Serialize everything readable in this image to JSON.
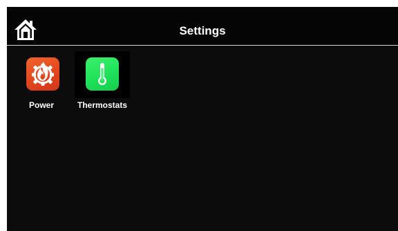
{
  "header": {
    "title": "Settings",
    "home_icon": "home-icon"
  },
  "tiles": [
    {
      "label": "Power",
      "icon": "power-flame-gear-icon",
      "color": "#e8501f",
      "selected": false
    },
    {
      "label": "Thermostats",
      "icon": "thermometer-icon",
      "color": "#22e05a",
      "selected": true
    }
  ],
  "colors": {
    "background": "#0c0c0c",
    "header_divider": "#d8d8d8",
    "text": "#ffffff"
  }
}
